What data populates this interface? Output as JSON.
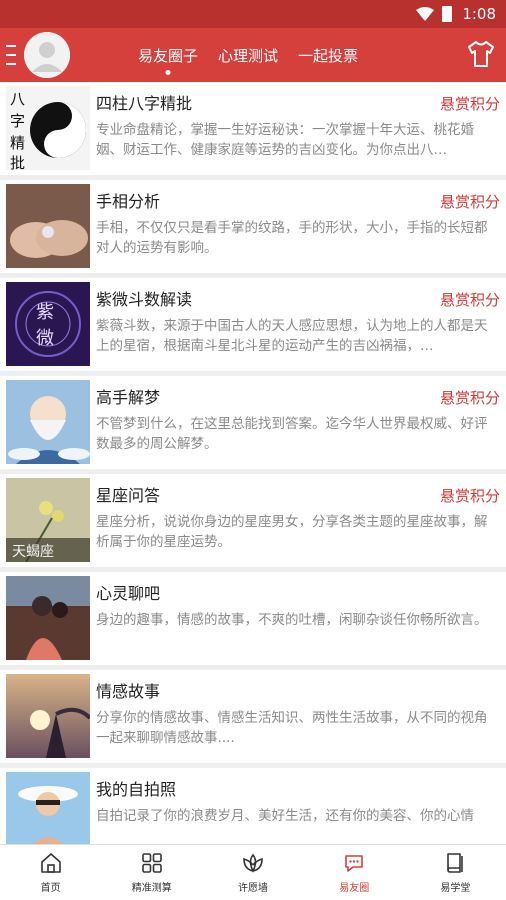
{
  "status_bar": {
    "time": "1:08",
    "icons": [
      "wifi-icon",
      "battery-icon"
    ]
  },
  "header": {
    "tabs": [
      {
        "label": "易友圈子",
        "active": true
      },
      {
        "label": "心理测试",
        "active": false
      },
      {
        "label": "一起投票",
        "active": false
      }
    ],
    "icons": [
      "menu-icon",
      "avatar",
      "shirt-icon"
    ]
  },
  "items": [
    {
      "title": "四柱八字精批",
      "badge": "悬赏积分",
      "desc": "专业命盘精论，掌握一生好运秘诀：一次掌握十年大运、桃花婚姻、财运工作、健康家庭等运势的吉凶变化。为你点出八…",
      "thumb_text": "八字精批",
      "thumb_colors": [
        "#ffffff",
        "#111111"
      ]
    },
    {
      "title": "手相分析",
      "badge": "悬赏积分",
      "desc": "手相，不仅仅只是看手掌的纹路，手的形状，大小，手指的长短都对人的运势有影响。",
      "thumb_colors": [
        "#d9b8a2",
        "#7a5a4a"
      ]
    },
    {
      "title": "紫微斗数解读",
      "badge": "悬赏积分",
      "desc": "紫薇斗数，来源于中国古人的天人感应思想，认为地上的人都是天上的星宿，根据南斗星北斗星的运动产生的吉凶祸福，…",
      "thumb_text": "紫微",
      "thumb_colors": [
        "#4a2a8a",
        "#1c0f3d"
      ]
    },
    {
      "title": "高手解梦",
      "badge": "悬赏积分",
      "desc": "不管梦到什么，在这里总能找到答案。迄今华人世界最权威、好评数最多的周公解梦。",
      "thumb_colors": [
        "#8fb4d8",
        "#f2f2f2"
      ]
    },
    {
      "title": "星座问答",
      "badge": "悬赏积分",
      "desc": "星座分析，说说你身边的星座男女，分享各类主题的星座故事，解析属于你的星座运势。",
      "thumb_text": "天蝎座",
      "thumb_colors": [
        "#c9c6a8",
        "#3a3a2a"
      ]
    },
    {
      "title": "心灵聊吧",
      "badge": "",
      "desc": "身边的趣事，情感的故事，不爽的吐槽，闲聊杂谈任你畅所欲言。",
      "thumb_colors": [
        "#7a4a3a",
        "#e07a6a"
      ]
    },
    {
      "title": "情感故事",
      "badge": "",
      "desc": "分享你的情感故事、情感生活知识、两性生活故事，从不同的视角一起来聊聊情感故事....",
      "thumb_colors": [
        "#c4a07a",
        "#5a4a5a"
      ]
    },
    {
      "title": "我的自拍照",
      "badge": "",
      "desc": "自拍记录了你的浪费岁月、美好生活，还有你的美容、你的心情",
      "thumb_colors": [
        "#9ac8e8",
        "#f0d0b0"
      ]
    }
  ],
  "bottom_nav": [
    {
      "label": "首页",
      "icon": "home-icon",
      "active": false
    },
    {
      "label": "精准测算",
      "icon": "grid-icon",
      "active": false
    },
    {
      "label": "许愿墙",
      "icon": "lotus-icon",
      "active": false
    },
    {
      "label": "易友圈",
      "icon": "chat-icon",
      "active": true
    },
    {
      "label": "易学堂",
      "icon": "book-icon",
      "active": false
    }
  ],
  "colors": {
    "primary": "#d6403c",
    "status_bar": "#b8312f",
    "badge": "#d23a36"
  }
}
